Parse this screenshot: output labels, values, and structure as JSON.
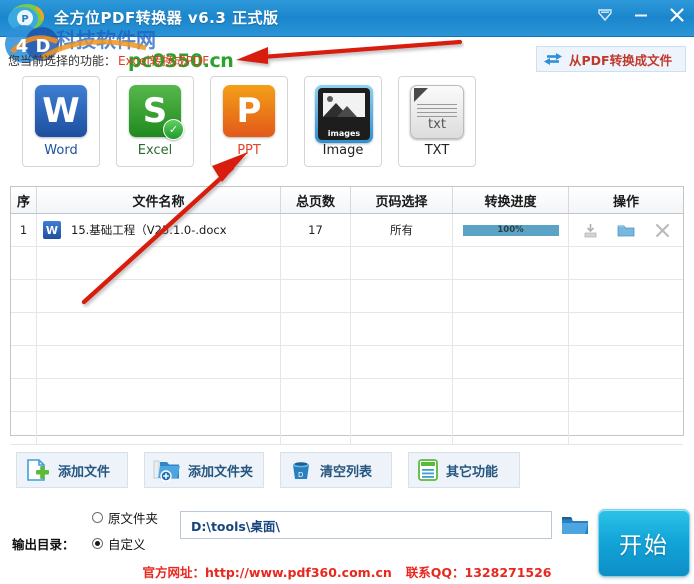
{
  "window": {
    "title": "全方位PDF转换器 v6.3 正式版",
    "controls": {
      "collapse": "collapse-icon",
      "minimize": "–",
      "close": "✕"
    }
  },
  "watermark": {
    "blue_text": "科技软件网",
    "green_text": "pc0350.cn"
  },
  "function_line": {
    "label": "您当前选择的功能：",
    "value": "Excel转换成PDF"
  },
  "from_pdf_button": {
    "label": "从PDF转换成文件",
    "icon": "swap-arrows-icon"
  },
  "formats": [
    {
      "label": "Word",
      "glyph": "W",
      "icon": "word-icon",
      "selected": false
    },
    {
      "label": "Excel",
      "glyph": "S",
      "icon": "excel-icon",
      "selected": true
    },
    {
      "label": "PPT",
      "glyph": "P",
      "icon": "ppt-icon",
      "selected": false
    },
    {
      "label": "Image",
      "glyph": "images",
      "icon": "image-icon",
      "selected": false
    },
    {
      "label": "TXT",
      "glyph": "txt",
      "icon": "txt-icon",
      "selected": false
    }
  ],
  "table": {
    "headers": [
      "序",
      "文件名称",
      "总页数",
      "页码选择",
      "转换进度",
      "操作"
    ],
    "rows": [
      {
        "index": "1",
        "file_icon": "word-doc-icon",
        "filename": "15.基础工程（V25.1.0-.docx",
        "pages": "17",
        "page_select": "所有",
        "progress": "100%",
        "progress_value": 100,
        "actions": [
          "save-icon",
          "open-folder-icon",
          "remove-icon"
        ]
      }
    ],
    "empty_rows": 6
  },
  "bottom_buttons": [
    {
      "label": "添加文件",
      "icon": "add-file-icon"
    },
    {
      "label": "添加文件夹",
      "icon": "add-folder-icon"
    },
    {
      "label": "清空列表",
      "icon": "trash-icon"
    },
    {
      "label": "其它功能",
      "icon": "list-icon"
    }
  ],
  "output": {
    "label": "输出目录：",
    "options": [
      {
        "label": "原文件夹",
        "selected": false
      },
      {
        "label": "自定义",
        "selected": true
      }
    ],
    "path": "D:\\tools\\桌面\\",
    "browse_icon": "folder-icon"
  },
  "start_button": {
    "label": "开始"
  },
  "footer": {
    "site_label": "官方网址：",
    "site_url": "http://www.pdf360.com.cn",
    "qq_label": "联系QQ：",
    "qq_number": "1328271526"
  },
  "colors": {
    "titlebar": "#1b86cd",
    "accent_red": "#e03a1e",
    "start_button": "#13a6d8",
    "progress": "#5ba3c4",
    "footer_red": "#e8281f"
  }
}
